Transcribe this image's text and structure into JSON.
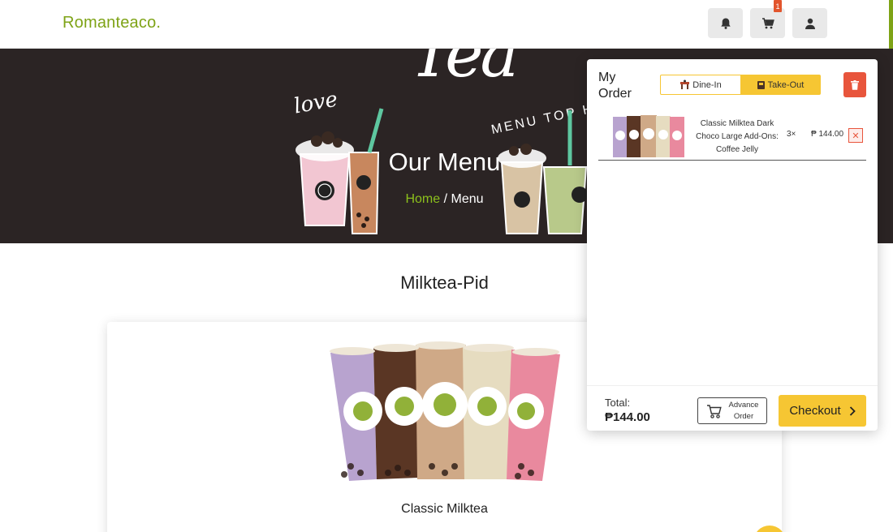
{
  "header": {
    "logo": "Romanteaco.",
    "cart_count": "1"
  },
  "hero": {
    "title": "Our Menu",
    "breadcrumb_home": "Home",
    "breadcrumb_sep": " / ",
    "breadcrumb_current": "Menu",
    "deco_tea": "Tea",
    "deco_love": "love",
    "deco_menu": "MENU TOP HI"
  },
  "section": {
    "title": "Milktea-Pid"
  },
  "product": {
    "name": "Classic Milktea"
  },
  "order": {
    "title": "My Order",
    "mode_dine_in": "Dine-In",
    "mode_take_out": "Take-Out",
    "active_mode": "Take-Out",
    "item": {
      "name": "Classic Milktea Dark Choco Large Add-Ons: Coffee Jelly",
      "qty": "3×",
      "price": "₱ 144.00"
    },
    "total_label": "Total:",
    "total_value": "₱144.00",
    "advance_label": "Advance Order",
    "checkout_label": "Checkout"
  },
  "colors": {
    "brand_green": "#7ea316",
    "accent_yellow": "#f6c633",
    "danger_red": "#e8553c",
    "hero_bg": "#2b2424"
  },
  "icons": [
    "bell-icon",
    "cart-icon",
    "user-icon",
    "trash-icon",
    "cart-outline-icon",
    "chevron-right-icon",
    "close-icon"
  ]
}
